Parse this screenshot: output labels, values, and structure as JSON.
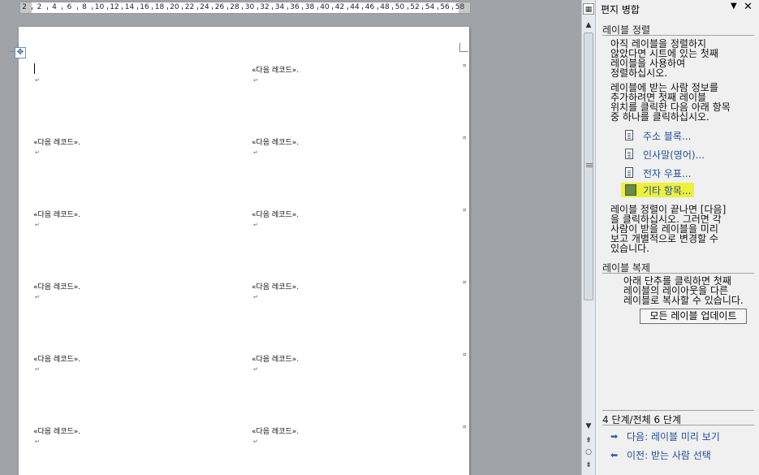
{
  "ruler": {
    "labels": [
      "2",
      "2",
      "4",
      "6",
      "8",
      "10",
      "12",
      "14",
      "16",
      "18",
      "20",
      "22",
      "24",
      "26",
      "28",
      "30",
      "32",
      "34",
      "36",
      "38",
      "40",
      "42",
      "44",
      "46",
      "48",
      "50",
      "52",
      "54",
      "56",
      "58"
    ]
  },
  "document": {
    "label_cells": [
      "«다음 레코드»",
      "«다음 레코드»",
      "«다음 레코드»",
      "«다음 레코드»",
      "«다음 레코드»",
      "«다음 레코드»",
      "«다음 레코드»",
      "«다음 레코드»",
      "«다음 레코드»",
      "«다음 레코드»",
      "«다음 레코드»"
    ]
  },
  "pane": {
    "title": "편지 병합",
    "dropdown_glyph": "▼",
    "close_glyph": "✕",
    "section1": {
      "heading": "레이블 정렬",
      "para1": [
        "아직 레이블을 정렬하지",
        "않았다면 시트에 있는 첫째",
        "레이블을 사용하여",
        "정렬하십시오."
      ],
      "para2": [
        "레이블에 받는 사람 정보를",
        "추가하려면 첫째 레이블",
        "위치를 클릭한 다음 아래 항목",
        "중 하나를 클릭하십시오."
      ],
      "links": [
        {
          "label": "주소 블록...",
          "icon": "address-block-icon"
        },
        {
          "label": "인사말(영어)...",
          "icon": "greeting-icon"
        },
        {
          "label": "전자 우표...",
          "icon": "postage-icon"
        },
        {
          "label": "기타 항목...",
          "icon": "more-items-icon",
          "highlight": "#eef13a"
        }
      ],
      "para3": [
        "레이블 정렬이 끝나면 [다음]",
        "을 클릭하십시오. 그러면 각",
        "사람이 받을 레이블을 미리",
        "보고 개별적으로 변경할 수",
        "있습니다."
      ]
    },
    "section2": {
      "heading": "레이블 복제",
      "para": [
        "아래 단추를 클릭하면 첫째",
        "레이블의 레이아웃을 다른",
        "레이블로 복사할 수 있습니다."
      ],
      "button": "모든 레이블 업데이트"
    },
    "step": "4 단계/전체 6 단계",
    "next": "다음: 레이블 미리 보기",
    "prev": "이전: 받는 사람 선택"
  },
  "colors": {
    "link": "#1f4e9a",
    "highlight": "#eef13a",
    "page_bg": "#a0a3a8"
  }
}
